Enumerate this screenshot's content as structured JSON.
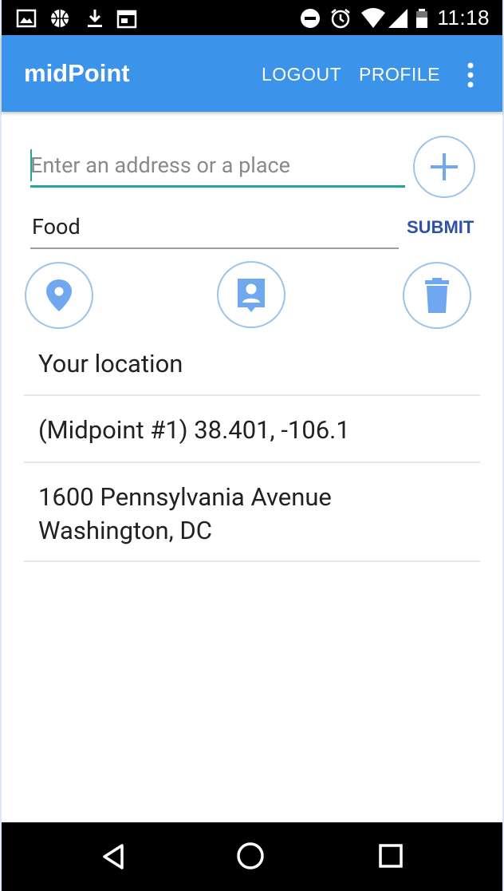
{
  "status_bar": {
    "time": "11:18",
    "icons": [
      "image-icon",
      "basketball-icon",
      "download-icon",
      "calendar-icon",
      "dnd-icon",
      "alarm-icon",
      "wifi-icon",
      "signal-icon",
      "battery-icon"
    ]
  },
  "app_bar": {
    "title": "midPoint",
    "logout_label": "LOGOUT",
    "profile_label": "PROFILE"
  },
  "form": {
    "address_placeholder": "Enter an address or a place",
    "category_value": "Food",
    "submit_label": "SUBMIT"
  },
  "locations": [
    {
      "text": "Your location"
    },
    {
      "text": "(Midpoint #1) 38.401, -106.1"
    },
    {
      "line1": "1600 Pennsylvania Avenue",
      "line2": "Washington, DC"
    }
  ],
  "colors": {
    "app_bar": "#3c93ea",
    "accent": "#26a69a",
    "icon_blue": "#6fa8ee",
    "submit": "#2d52a8"
  }
}
